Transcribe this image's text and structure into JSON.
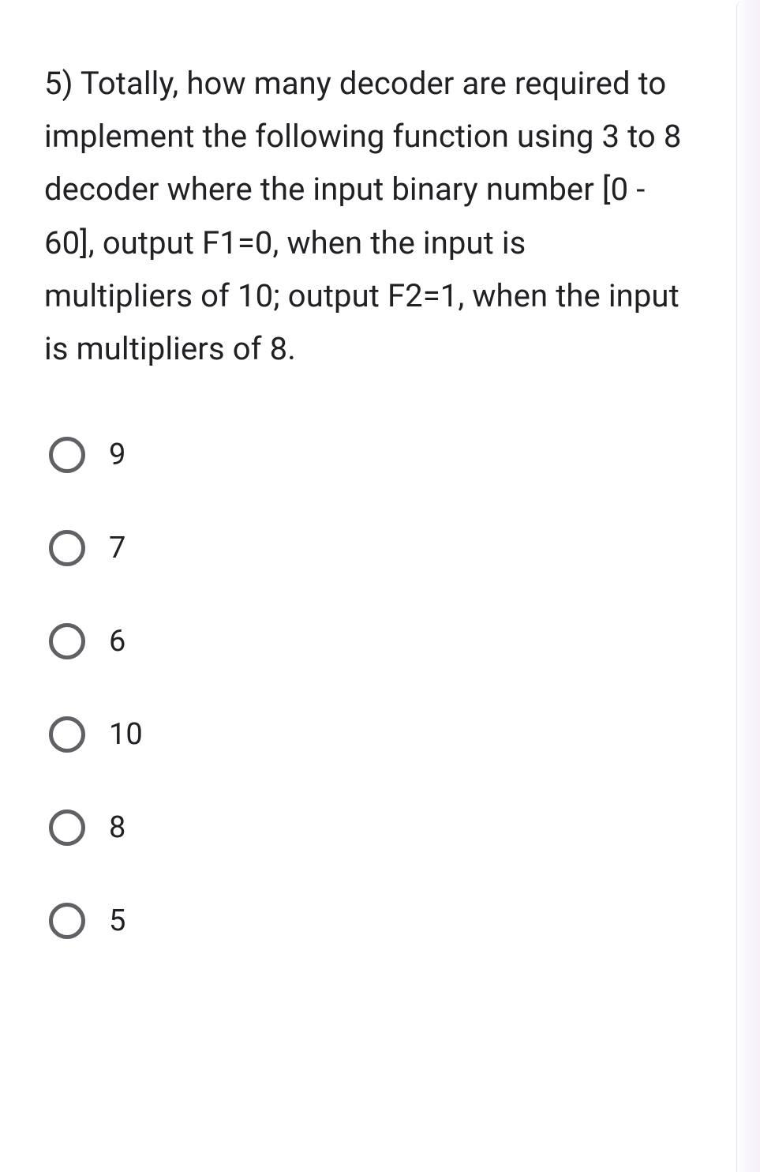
{
  "question": {
    "text": "5) Totally, how many decoder are required to implement the following function using 3 to 8 decoder where the input binary number [0 - 60], output F1=0, when the input is multipliers of 10; output F2=1, when the input is multipliers of 8."
  },
  "options": [
    {
      "label": "9"
    },
    {
      "label": "7"
    },
    {
      "label": "6"
    },
    {
      "label": "10"
    },
    {
      "label": "8"
    },
    {
      "label": "5"
    }
  ]
}
